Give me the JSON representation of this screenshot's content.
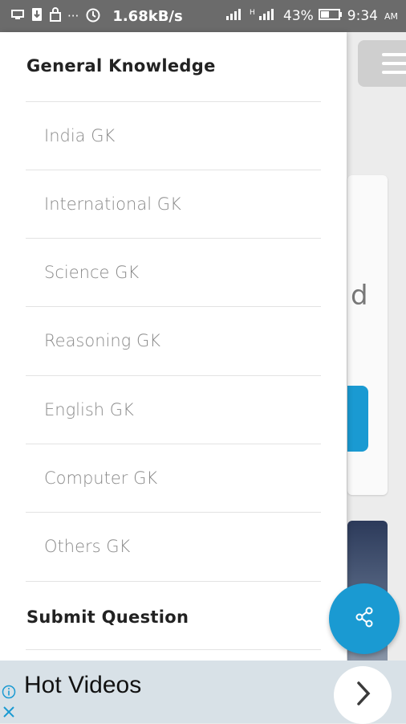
{
  "status_bar": {
    "speed": "1.68kB/s",
    "signal_label": "H",
    "battery": "43%",
    "time": "9:34",
    "ampm": "AM"
  },
  "drawer": {
    "section_title": "General Knowledge",
    "items": [
      {
        "label": "India GK"
      },
      {
        "label": "International GK"
      },
      {
        "label": "Science GK"
      },
      {
        "label": "Reasoning GK"
      },
      {
        "label": "English GK"
      },
      {
        "label": "Computer GK"
      },
      {
        "label": "Others GK"
      }
    ],
    "submit_label": "Submit Question"
  },
  "background": {
    "partial_text": "d"
  },
  "ad": {
    "title": "Hot Videos"
  },
  "colors": {
    "accent": "#1a9ad2",
    "status_bar": "#6b6b6b",
    "ad_bg": "#d8e1e7"
  }
}
